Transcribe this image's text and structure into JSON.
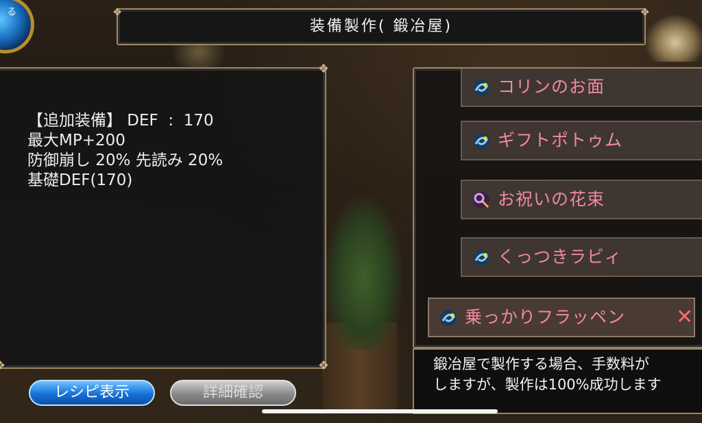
{
  "header": {
    "title": "装備製作(  鍛冶屋)"
  },
  "corner_button": {
    "label": "る"
  },
  "stats": {
    "lines": [
      "【追加装備】 DEF  :  170",
      "最大MP+200",
      "防御崩し 20% 先読み 20%",
      "基礎DEF(170)"
    ]
  },
  "recipe_list": {
    "items": [
      {
        "label": "コリンのお面",
        "icon": "blue-swirl-icon"
      },
      {
        "label": "ギフトポトゥム",
        "icon": "blue-swirl-icon"
      },
      {
        "label": "お祝いの花束",
        "icon": "purple-wand-icon"
      },
      {
        "label": "くっつきラビィ",
        "icon": "blue-swirl-icon"
      },
      {
        "label": "乗っかりフラッペン",
        "icon": "blue-swirl-icon",
        "selected": true
      }
    ],
    "close_symbol": "✕"
  },
  "description": {
    "line1": "鍛冶屋で製作する場合、手数料が",
    "line2": "しますが、製作は100%成功します"
  },
  "buttons": {
    "recipe": "レシピ表示",
    "detail": "詳細確認"
  },
  "colors": {
    "item_text": "#f08aa0",
    "recipe_button": "#1672d8",
    "detail_button": "#8a8a8a",
    "frame": "#9a8660"
  }
}
